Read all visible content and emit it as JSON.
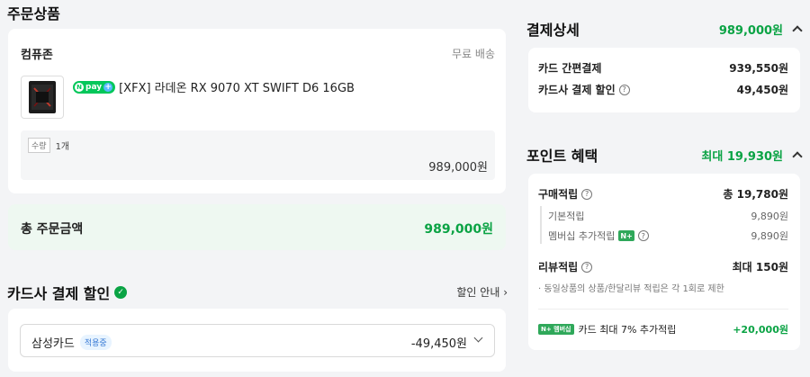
{
  "order": {
    "section_title": "주문상품",
    "seller": "컴퓨존",
    "shipping": "무료 배송",
    "npay_label": "pay",
    "product_name": "[XFX] 라데온 RX 9070 XT SWIFT D6 16GB",
    "qty_label": "수량",
    "qty_value": "1개",
    "price": "989,000원",
    "total_label": "총 주문금액",
    "total_value": "989,000원"
  },
  "card_discount": {
    "title": "카드사 결제 할인",
    "link": "할인 안내",
    "card_name": "삼성카드",
    "applied_badge": "적용중",
    "amount": "-49,450원"
  },
  "payment": {
    "title": "결제상세",
    "total": "989,000원",
    "rows": [
      {
        "label": "카드 간편결제",
        "value": "939,550원"
      },
      {
        "label": "카드사 결제 할인",
        "value": "49,450원"
      }
    ]
  },
  "points": {
    "title": "포인트 혜택",
    "max": "최대 19,930원",
    "purchase_label": "구매적립",
    "purchase_value": "총 19,780원",
    "basic_label": "기본적립",
    "basic_value": "9,890원",
    "member_label": "멤버십 추가적립",
    "member_value": "9,890원",
    "review_label": "리뷰적립",
    "review_value": "최대 150원",
    "review_note": "· 동일상품의 상품/한달리뷰 적립은 각 1회로 제한",
    "card_badge": "멤버십",
    "card_text": "카드 최대 7% 추가적립",
    "card_value": "+20,000원"
  }
}
